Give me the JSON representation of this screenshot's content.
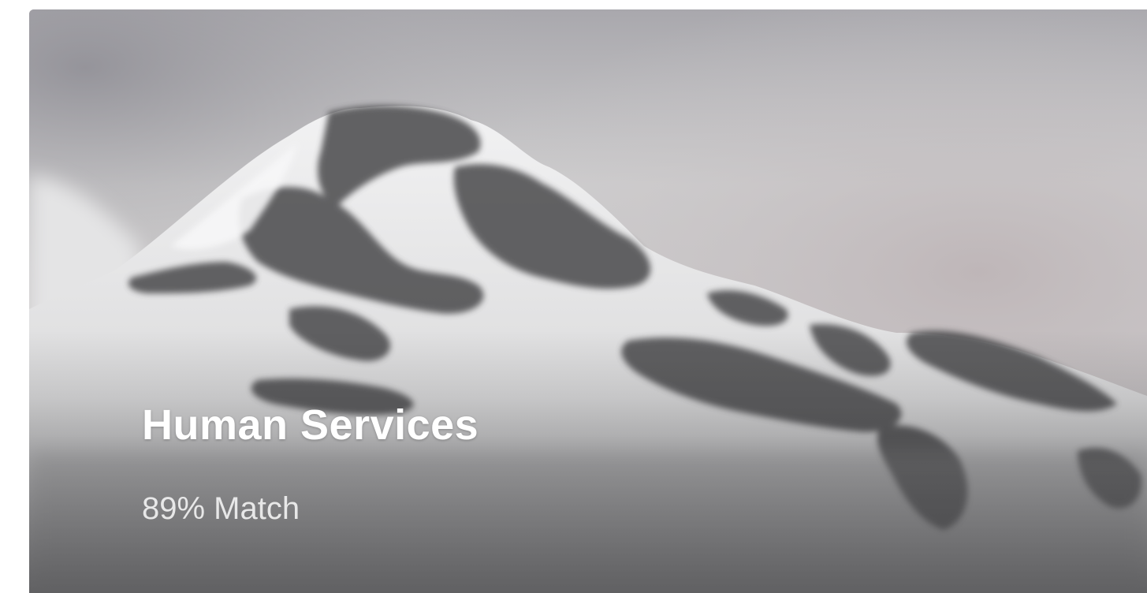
{
  "card": {
    "title": "Human Services",
    "match_text": "89% Match",
    "match_percent": 89,
    "background_image": "snowy-mountain-peak-photo"
  }
}
